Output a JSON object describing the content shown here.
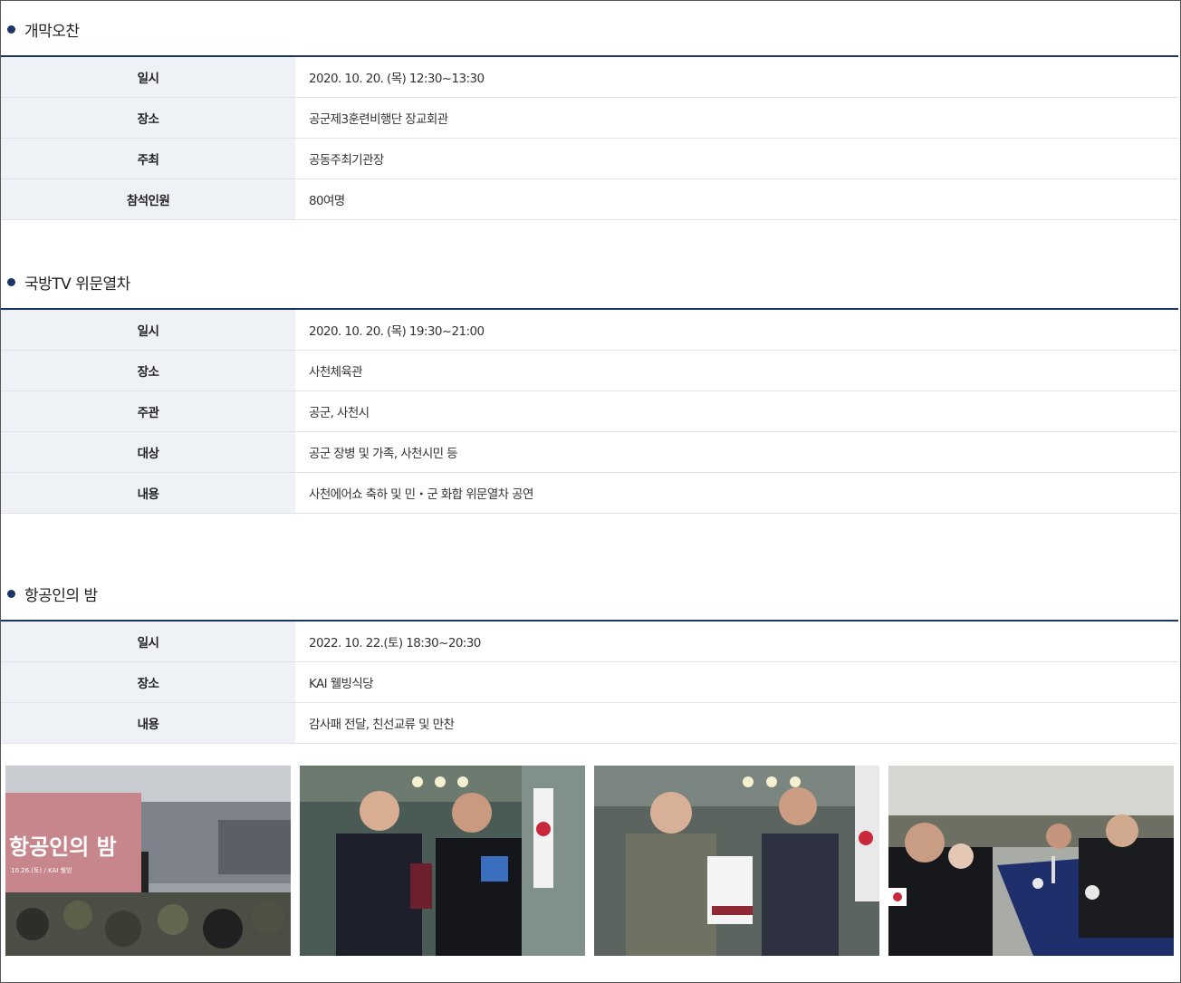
{
  "sections": [
    {
      "title": "개막오찬",
      "rows": [
        {
          "label": "일시",
          "value": "2020. 10. 20. (목) 12:30~13:30"
        },
        {
          "label": "장소",
          "value": "공군제3훈련비행단 장교회관"
        },
        {
          "label": "주최",
          "value": "공동주최기관장"
        },
        {
          "label": "참석인원",
          "value": "80여명"
        }
      ]
    },
    {
      "title": "국방TV 위문열차",
      "rows": [
        {
          "label": "일시",
          "value": "2020. 10. 20. (목) 19:30~21:00"
        },
        {
          "label": "장소",
          "value": "사천체육관"
        },
        {
          "label": "주관",
          "value": "공군, 사천시"
        },
        {
          "label": "대상",
          "value": "공군 장병 및 가족, 사천시민 등"
        },
        {
          "label": "내용",
          "value": "사천에어쇼 축하 및 민・군 화합 위문열차 공연"
        }
      ]
    },
    {
      "title": "항공인의 밤",
      "rows": [
        {
          "label": "일시",
          "value": "2022. 10. 22.(토) 18:30~20:30"
        },
        {
          "label": "장소",
          "value": "KAI 웰빙식당"
        },
        {
          "label": "내용",
          "value": "감사패 전달, 친선교류 및 만찬"
        }
      ]
    }
  ],
  "photos": {
    "banner_text": "항공인의 밤",
    "banner_sub": "10.26.(토) / KAI 웰빙",
    "items": [
      "event-hall-photo",
      "plaque-presentation-photo-1",
      "plaque-presentation-photo-2",
      "dinner-toast-photo"
    ]
  },
  "colors": {
    "accent": "#1b3566",
    "header_bg": "#eef1f6",
    "border": "#dfe3ea"
  }
}
